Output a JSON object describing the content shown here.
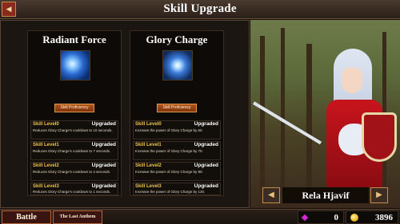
{
  "header": {
    "title": "Skill Upgrade",
    "back_icon": "◀"
  },
  "skills": [
    {
      "name": "Radiant Force",
      "proficiency_label": "Skill Proficiency",
      "levels": [
        {
          "name": "Skill Level0",
          "status": "Upgraded",
          "desc": "Reduces Glory Charge's cooldown to 10 seconds."
        },
        {
          "name": "Skill Level1",
          "status": "Upgraded",
          "desc": "Reduces Glory Charge's cooldown to 7 seconds."
        },
        {
          "name": "Skill Level2",
          "status": "Upgraded",
          "desc": "Reduces Glory Charge's cooldown to 4 seconds."
        },
        {
          "name": "Skill Level3",
          "status": "Upgraded",
          "desc": "Reduces Glory Charge's cooldown to 1 seconds."
        }
      ]
    },
    {
      "name": "Glory Charge",
      "proficiency_label": "Skill Proficiency",
      "levels": [
        {
          "name": "Skill Level0",
          "status": "Upgraded",
          "desc": "Increase the power of Glory Charge by 60."
        },
        {
          "name": "Skill Level1",
          "status": "Upgraded",
          "desc": "Increase the power of Glory Charge by 70."
        },
        {
          "name": "Skill Level2",
          "status": "Upgraded",
          "desc": "Increase the power of Glory Charge by 90."
        },
        {
          "name": "Skill Level3",
          "status": "Upgraded",
          "desc": "Increase the power of Glory Charge by 120."
        }
      ]
    }
  ],
  "character": {
    "name": "Rela Hjavif",
    "prev_icon": "◀",
    "next_icon": "▶"
  },
  "footer": {
    "battle_label": "Battle",
    "anthem_label": "The Last Anthem",
    "gems": "0",
    "gold": "3896"
  },
  "colors": {
    "level_title": "#f1c44d",
    "accent_red": "#8a2a1e",
    "gem": "#d02ad0",
    "gold": "#e8b81a"
  }
}
